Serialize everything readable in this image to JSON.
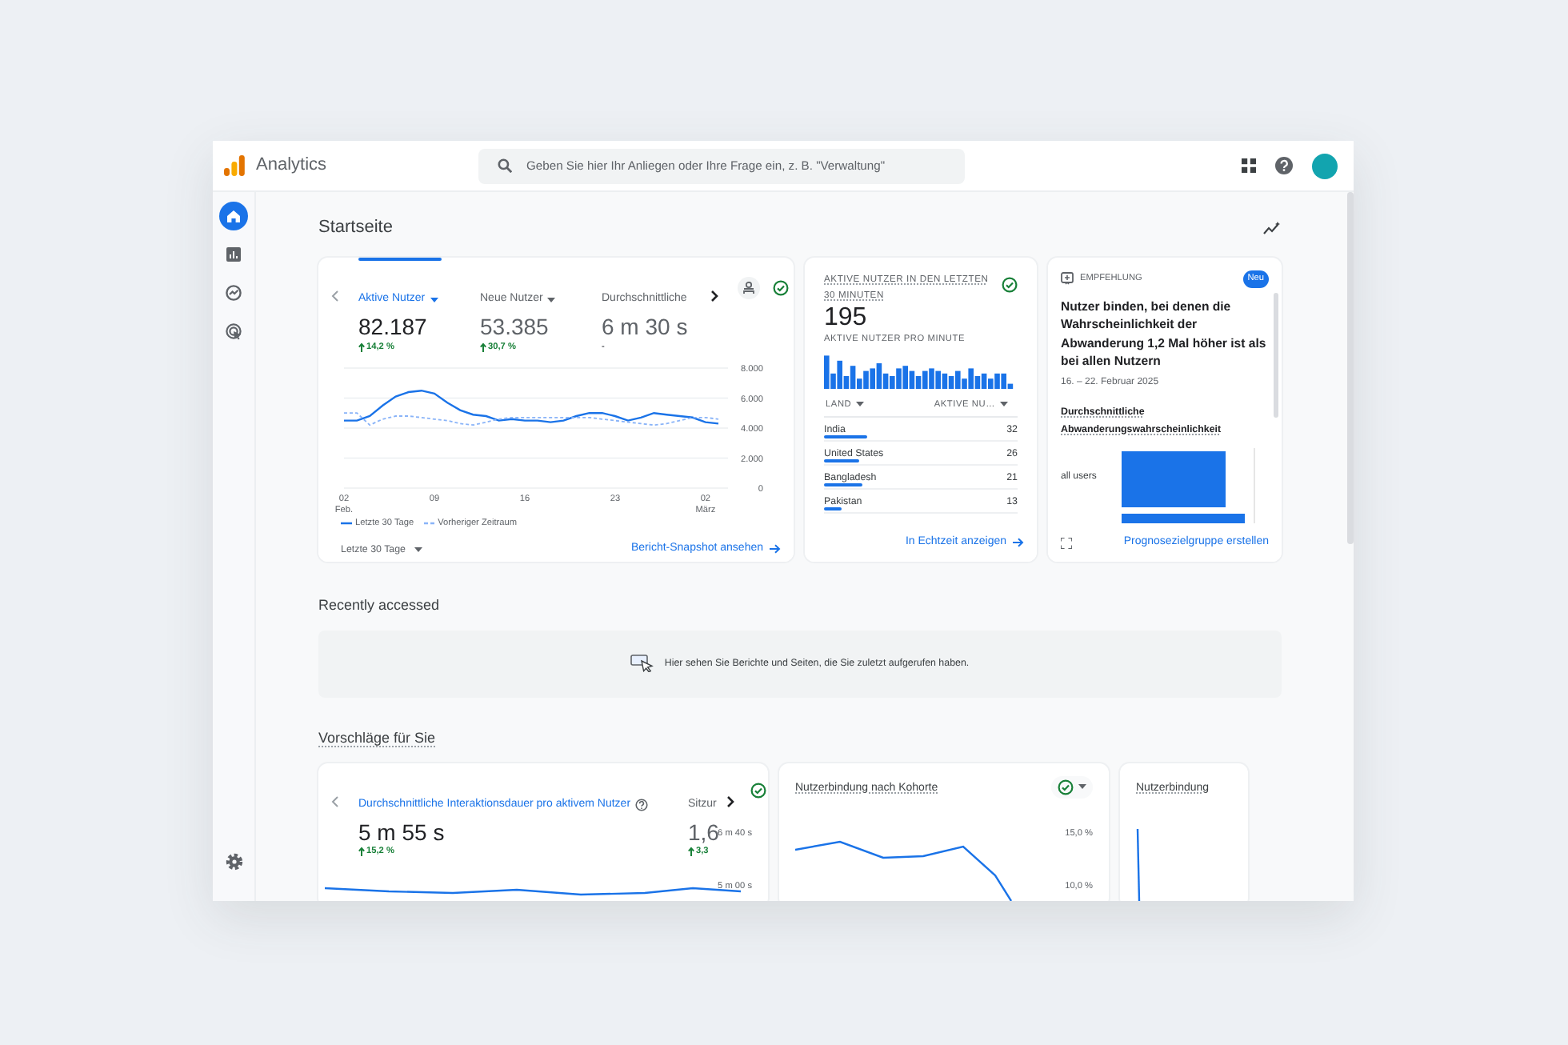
{
  "app": {
    "name": "Analytics"
  },
  "search": {
    "placeholder": "Geben Sie hier Ihr Anliegen oder Ihre Frage ein, z. B. \"Verwaltung\""
  },
  "sidebar": {
    "items": [
      {
        "kind": "home",
        "selected": true
      },
      {
        "kind": "reports",
        "selected": false
      },
      {
        "kind": "explore",
        "selected": false
      },
      {
        "kind": "advertising",
        "selected": false
      }
    ]
  },
  "page": {
    "title": "Startseite"
  },
  "overview_card": {
    "metrics": [
      {
        "label": "Aktive Nutzer",
        "value": "82.187",
        "change": "14,2 %",
        "trend_arrow": true,
        "dropdown": true,
        "selected": true
      },
      {
        "label": "Neue Nutzer",
        "value": "53.385",
        "change": "30,7 %",
        "trend_arrow": true,
        "dropdown": true,
        "selected": false
      },
      {
        "label": "Durchschnittliche",
        "value": "6 m 30 s",
        "change": "-",
        "trend_arrow": false,
        "dropdown": false,
        "selected": false
      }
    ],
    "chart_data": {
      "type": "line",
      "grid": true,
      "categories": [
        "02 Feb.",
        null,
        null,
        null,
        null,
        null,
        null,
        "09",
        null,
        null,
        null,
        null,
        null,
        null,
        "16",
        null,
        null,
        null,
        null,
        null,
        null,
        "23",
        null,
        null,
        null,
        null,
        null,
        null,
        "02 März",
        null
      ],
      "ylim": [
        0,
        8000
      ],
      "yticks": [
        {
          "value": 0,
          "label": "0"
        },
        {
          "value": 2000,
          "label": "2.000"
        },
        {
          "value": 4000,
          "label": "4.000"
        },
        {
          "value": 6000,
          "label": "6.000"
        },
        {
          "value": 8000,
          "label": "8.000"
        }
      ],
      "series": [
        {
          "name": "Letzte 30 Tage",
          "color": "#1a73e8",
          "line_style": "solid",
          "values": [
            4500,
            4500,
            4800,
            5500,
            6100,
            6400,
            6500,
            6300,
            5700,
            5200,
            4900,
            4800,
            4500,
            4600,
            4500,
            4500,
            4400,
            4500,
            4800,
            5000,
            5000,
            4800,
            4500,
            4700,
            5000,
            4900,
            4800,
            4700,
            4400,
            4300
          ]
        },
        {
          "name": "Vorheriger Zeitraum",
          "color": "#8ab4f8",
          "line_style": "dashed",
          "values": [
            5000,
            5000,
            4200,
            4600,
            4800,
            4800,
            4700,
            4600,
            4500,
            4300,
            4200,
            4400,
            4600,
            4700,
            4700,
            4700,
            4700,
            4700,
            4700,
            4700,
            4600,
            4500,
            4400,
            4300,
            4200,
            4300,
            4500,
            4700,
            4700,
            4600
          ]
        }
      ]
    },
    "period_select": "Letzte 30 Tage",
    "link": "Bericht-Snapshot ansehen"
  },
  "realtime_card": {
    "title": "AKTIVE NUTZER IN DEN LETZTEN 30 MINUTEN",
    "value": "195",
    "subtitle": "AKTIVE NUTZER PRO MINUTE",
    "columns": [
      "LAND",
      "AKTIVE NU…"
    ],
    "rows": [
      {
        "country": "India",
        "users": "32",
        "level": 0.22
      },
      {
        "country": "United States",
        "users": "26",
        "level": 0.18
      },
      {
        "country": "Bangladesh",
        "users": "21",
        "level": 0.2
      },
      {
        "country": "Pakistan",
        "users": "13",
        "level": 0.09
      }
    ],
    "link": "In Echtzeit anzeigen"
  },
  "recommendation_card": {
    "label": "EMPFEHLUNG",
    "badge": "Neu",
    "title": "Nutzer binden, bei denen die Wahrscheinlichkeit der Abwanderung 1,2 Mal höher ist als bei allen Nutzern",
    "date": "16. – 22. Februar 2025",
    "metric": "Durchschnittliche Abwanderungswahrscheinlichkeit",
    "bar_label": "all users",
    "link": "Prognosezielgruppe erstellen"
  },
  "recently_accessed": {
    "title": "Recently accessed",
    "empty_text": "Hier sehen Sie Berichte und Seiten, die Sie zuletzt aufgerufen haben."
  },
  "suggestions": {
    "title": "Vorschläge für Sie",
    "cards": [
      {
        "kind": "metric_tabs",
        "metrics": [
          {
            "label": "Durchschnittliche Interaktionsdauer pro aktivem Nutzer",
            "value": "5 m 55 s",
            "change": "15,2 %",
            "selected": true
          },
          {
            "label": "Sitzur",
            "value": "1,6",
            "change": "3,3",
            "selected": false
          }
        ],
        "axis_labels": [
          "6 m 40 s",
          "5 m 00 s"
        ]
      },
      {
        "kind": "chart",
        "title": "Nutzerbindung nach Kohorte",
        "axis_labels": [
          "15,0 %",
          "10,0 %"
        ]
      },
      {
        "kind": "chart",
        "title": "Nutzerbindung"
      }
    ]
  }
}
